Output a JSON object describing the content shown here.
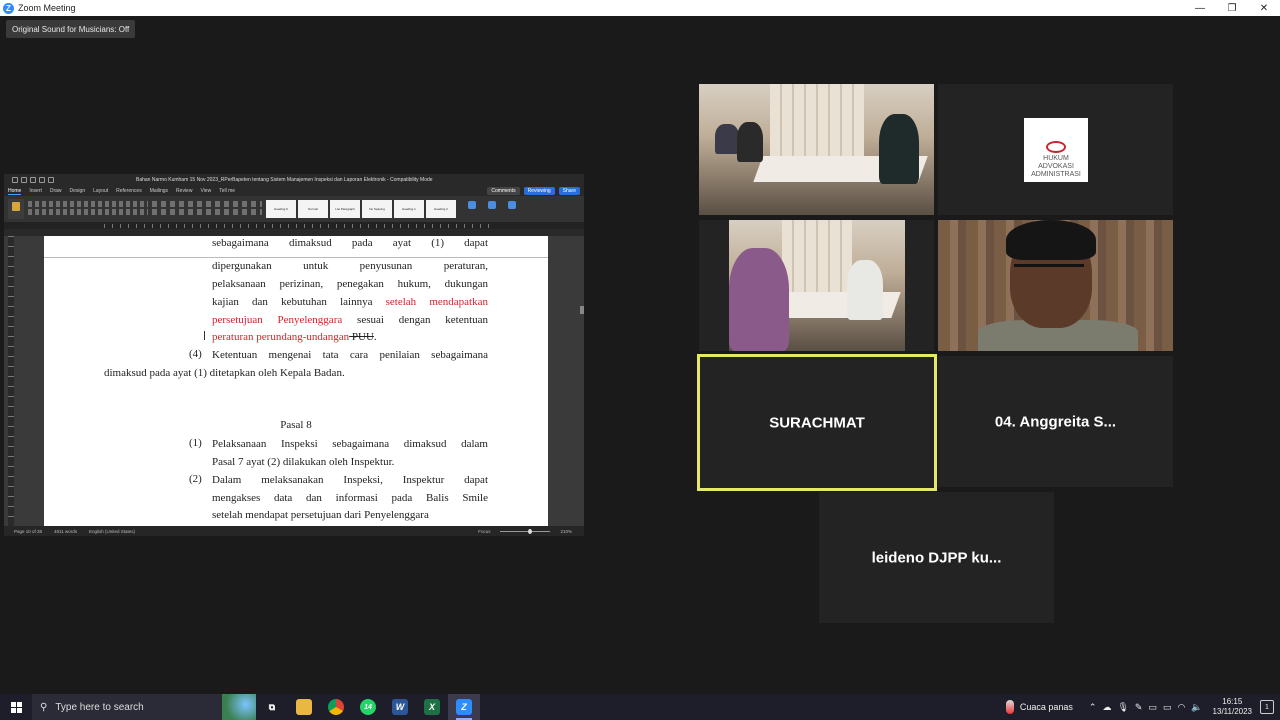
{
  "window": {
    "title": "Zoom Meeting",
    "logo_letter": "Z",
    "minimize": "—",
    "restore": "❐",
    "close": "✕"
  },
  "original_sound": "Original Sound for Musicians: Off",
  "word": {
    "doc_title": "Bahan Narmo Kumham 15 Nov 2023_RPerBapeten tentang Sistem Manajemen Inspeksi dan Laporan Elektronik  -  Compatibility Mode",
    "tabs": [
      "Home",
      "Insert",
      "Draw",
      "Design",
      "Layout",
      "References",
      "Mailings",
      "Review",
      "View",
      "Tell me"
    ],
    "btn_comments": "Comments",
    "btn_reviewing": "Reviewing",
    "btn_share": "Share",
    "paste_label": "Paste",
    "styles": [
      "Heading 6",
      "Normal",
      "List Paragraph",
      "No Spacing",
      "Heading 1",
      "Heading 2"
    ],
    "tools": [
      "Styles Pane",
      "Dictate",
      "Editor"
    ],
    "doc": {
      "l0": "sebagaimana dimaksud pada ayat (1) dapat",
      "l1": "dipergunakan untuk penyusunan peraturan,",
      "l2": "pelaksanaan perizinan, penegakan hukum, dukungan",
      "l3a": "kajian dan kebutuhan lainnya ",
      "l3b": "setelah mendapatkan",
      "l4a": "persetujuan Penyelenggara",
      "l4b": " sesuai dengan ketentuan",
      "l5a": "peraturan perundang-undangan",
      "l5b": " PUU",
      "l5c": ".",
      "n4": "(4)",
      "l6": "Ketentuan mengenai tata cara penilaian sebagaimana",
      "l7": "dimaksud pada ayat (1) ditetapkan oleh Kepala Badan.",
      "pasal": "Pasal 8",
      "n1": "(1)",
      "l8": "Pelaksanaan Inspeksi sebagaimana dimaksud dalam",
      "l9": "Pasal 7 ayat (2) dilakukan oleh Inspektur.",
      "n2": "(2)",
      "l10": "Dalam melaksanakan Inspeksi, Inspektur dapat",
      "l11": "mengakses data dan informasi pada Balis Smile",
      "l12": "setelah mendapat persetujuan dari Penyelenggara"
    },
    "status": {
      "page": "Page 10 of 38",
      "words": "4911 words",
      "lang": "English (United States)",
      "focus": "Focus",
      "zoom": "210%"
    }
  },
  "participants": {
    "p3_name": "SURACHMAT",
    "p4_name": "04. Anggreita S...",
    "p5_name": "leideno DJPP ku...",
    "logo_text": [
      "HUKUM",
      "ADVOKASI",
      "ADMINISTRASI"
    ]
  },
  "taskbar": {
    "search_placeholder": "Type here to search",
    "whatsapp_badge": "14",
    "weather": "Cuaca panas",
    "time": "16:15",
    "date": "13/11/2023",
    "notif_count": "1"
  },
  "colors": {
    "active_speaker_border": "#e6e86a",
    "tracked_change_red": "#d0262b",
    "word_accent": "#2b6fd6"
  }
}
